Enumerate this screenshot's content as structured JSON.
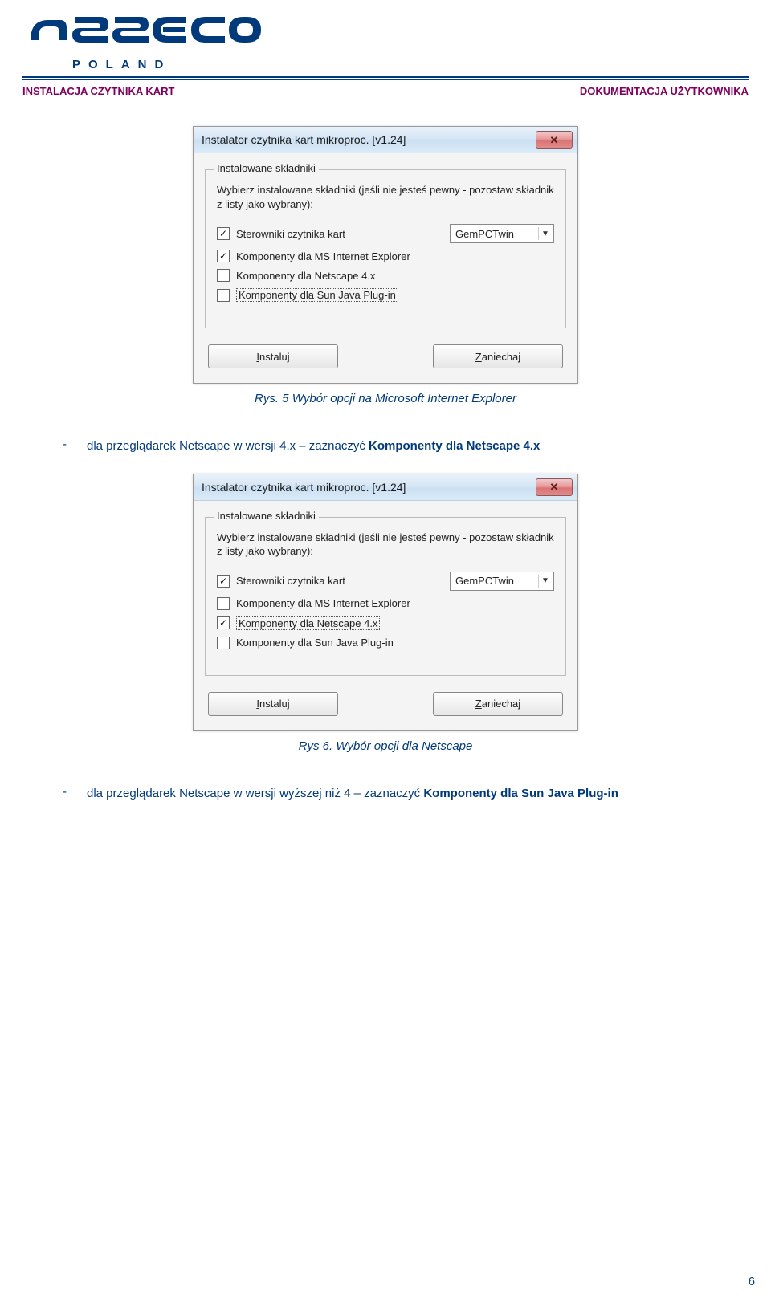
{
  "header": {
    "logo_sub": "POLAND",
    "left": "INSTALACJA CZYTNIKA KART",
    "right": "DOKUMENTACJA UŻYTKOWNIKA"
  },
  "dialog": {
    "title": "Instalator czytnika kart mikroproc. [v1.24]",
    "group_title": "Instalowane składniki",
    "group_desc": "Wybierz instalowane składniki (jeśli nie jesteś pewny - pozostaw składnik z listy jako wybrany):",
    "combo_value": "GemPCTwin",
    "btn_install_pre": "I",
    "btn_install_rest": "nstaluj",
    "btn_cancel_pre": "Z",
    "btn_cancel_rest": "aniechaj",
    "items": [
      {
        "label": "Sterowniki czytnika kart"
      },
      {
        "label": "Komponenty dla MS Internet Explorer"
      },
      {
        "label": "Komponenty dla Netscape 4.x"
      },
      {
        "label": "Komponenty dla Sun Java Plug-in"
      }
    ],
    "check_mark": "✓"
  },
  "dlg1_checked": [
    true,
    true,
    false,
    false
  ],
  "dlg1_dotted_idx": 3,
  "dlg2_checked": [
    true,
    false,
    true,
    false
  ],
  "dlg2_dotted_idx": 2,
  "caption1": "Rys. 5 Wybór opcji na Microsoft Internet Explorer",
  "bullet1_a": "dla przeglądarek Netscape w wersji 4.x – zaznaczyć ",
  "bullet1_b": "Komponenty dla Netscape 4.x",
  "caption2": "Rys 6. Wybór opcji dla Netscape",
  "bullet2_a": "dla przeglądarek Netscape w wersji wyższej niż 4 – zaznaczyć ",
  "bullet2_b": "Komponenty dla Sun Java Plug-in",
  "page_num": "6"
}
